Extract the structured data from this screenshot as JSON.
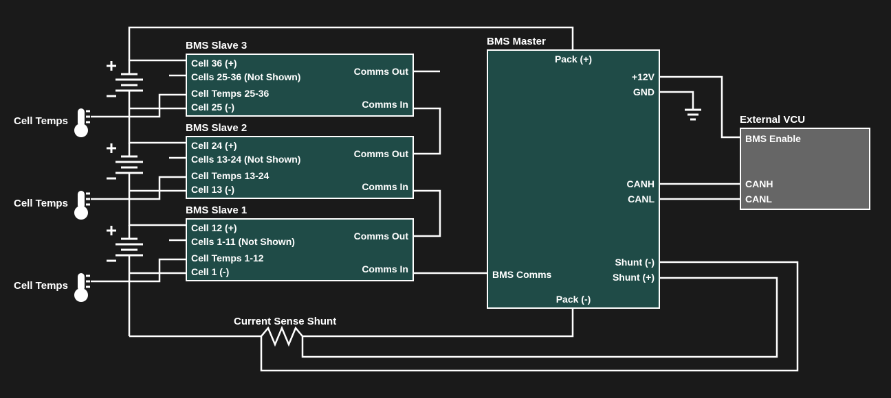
{
  "sideLabel": "Cell Temps",
  "shuntLabel": "Current Sense Shunt",
  "slaves": [
    {
      "title": "BMS Slave 3",
      "cellPos": "Cell 36 (+)",
      "cellsRange": "Cells 25-36 (Not Shown)",
      "tempsRange": "Cell Temps 25-36",
      "cellNeg": "Cell 25 (-)",
      "commsOut": "Comms Out",
      "commsIn": "Comms In"
    },
    {
      "title": "BMS Slave 2",
      "cellPos": "Cell 24 (+)",
      "cellsRange": "Cells 13-24 (Not Shown)",
      "tempsRange": "Cell Temps 13-24",
      "cellNeg": "Cell 13 (-)",
      "commsOut": "Comms Out",
      "commsIn": "Comms In"
    },
    {
      "title": "BMS Slave 1",
      "cellPos": "Cell 12 (+)",
      "cellsRange": "Cells 1-11 (Not Shown)",
      "tempsRange": "Cell Temps 1-12",
      "cellNeg": "Cell 1 (-)",
      "commsOut": "Comms Out",
      "commsIn": "Comms In"
    }
  ],
  "master": {
    "title": "BMS Master",
    "packPos": "Pack (+)",
    "packNeg": "Pack (-)",
    "p12v": "+12V",
    "gnd": "GND",
    "canh": "CANH",
    "canl": "CANL",
    "shuntNeg": "Shunt (-)",
    "shuntPos": "Shunt (+)",
    "bmsComms": "BMS Comms"
  },
  "vcu": {
    "title": "External VCU",
    "bmsEnable": "BMS Enable",
    "canh": "CANH",
    "canl": "CANL"
  }
}
